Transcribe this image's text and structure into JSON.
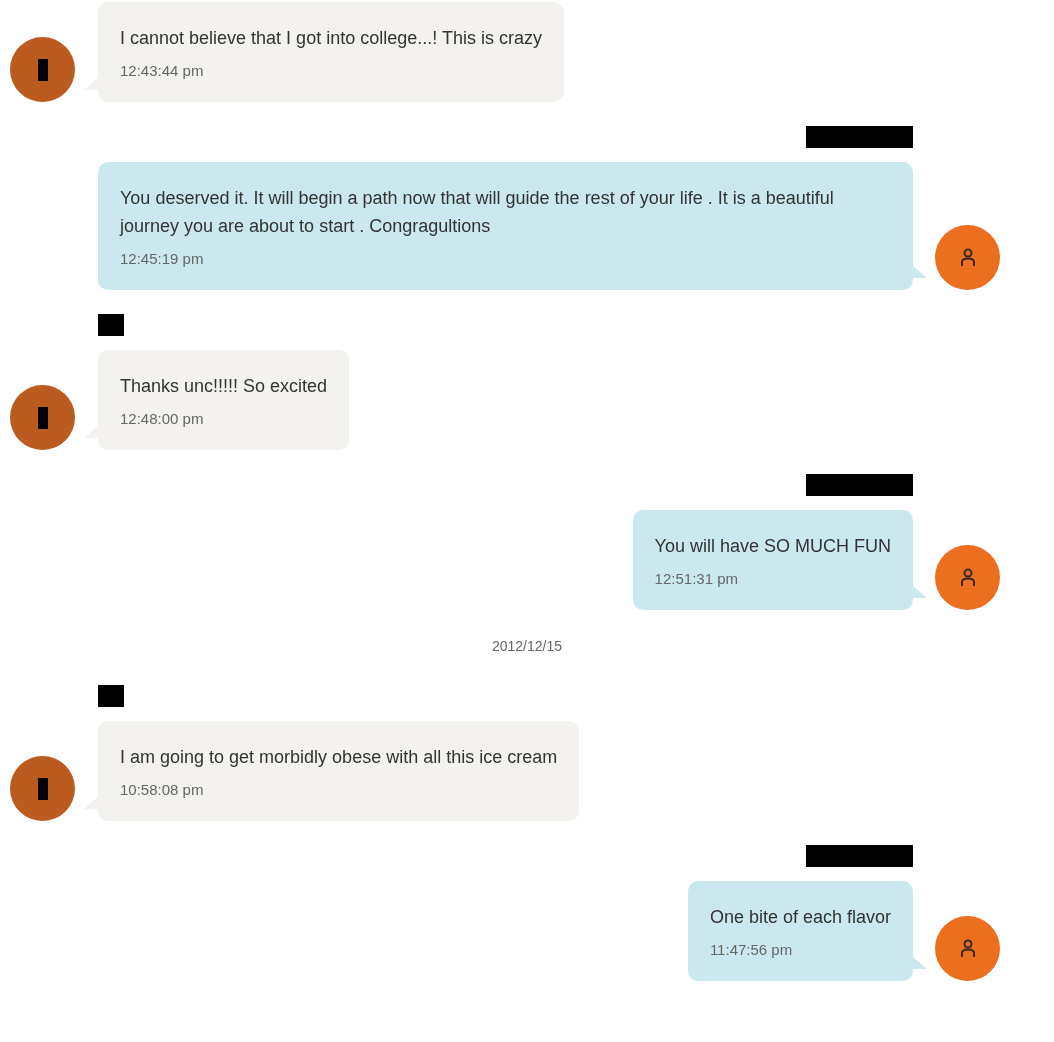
{
  "conversation": [
    {
      "kind": "incoming",
      "sender_redacted": false,
      "text": "I cannot believe that I got into college...! This is crazy",
      "time": "12:43:44 pm"
    },
    {
      "kind": "outgoing",
      "sender_redacted": true,
      "text": "You deserved it. It will begin a path now that will guide the rest of your life . It is a beautiful journey you are about to start . Congragultions",
      "time": "12:45:19 pm"
    },
    {
      "kind": "incoming",
      "sender_redacted": true,
      "text": "Thanks unc!!!!! So excited",
      "time": "12:48:00 pm"
    },
    {
      "kind": "outgoing",
      "sender_redacted": true,
      "text": "You will have SO MUCH FUN",
      "time": "12:51:31 pm"
    },
    {
      "kind": "date",
      "text": "2012/12/15"
    },
    {
      "kind": "incoming",
      "sender_redacted": true,
      "text": "I am going to get morbidly obese with all this ice cream",
      "time": "10:58:08 pm"
    },
    {
      "kind": "outgoing",
      "sender_redacted": true,
      "text": "One bite of each flavor",
      "time": "11:47:56 pm"
    }
  ]
}
